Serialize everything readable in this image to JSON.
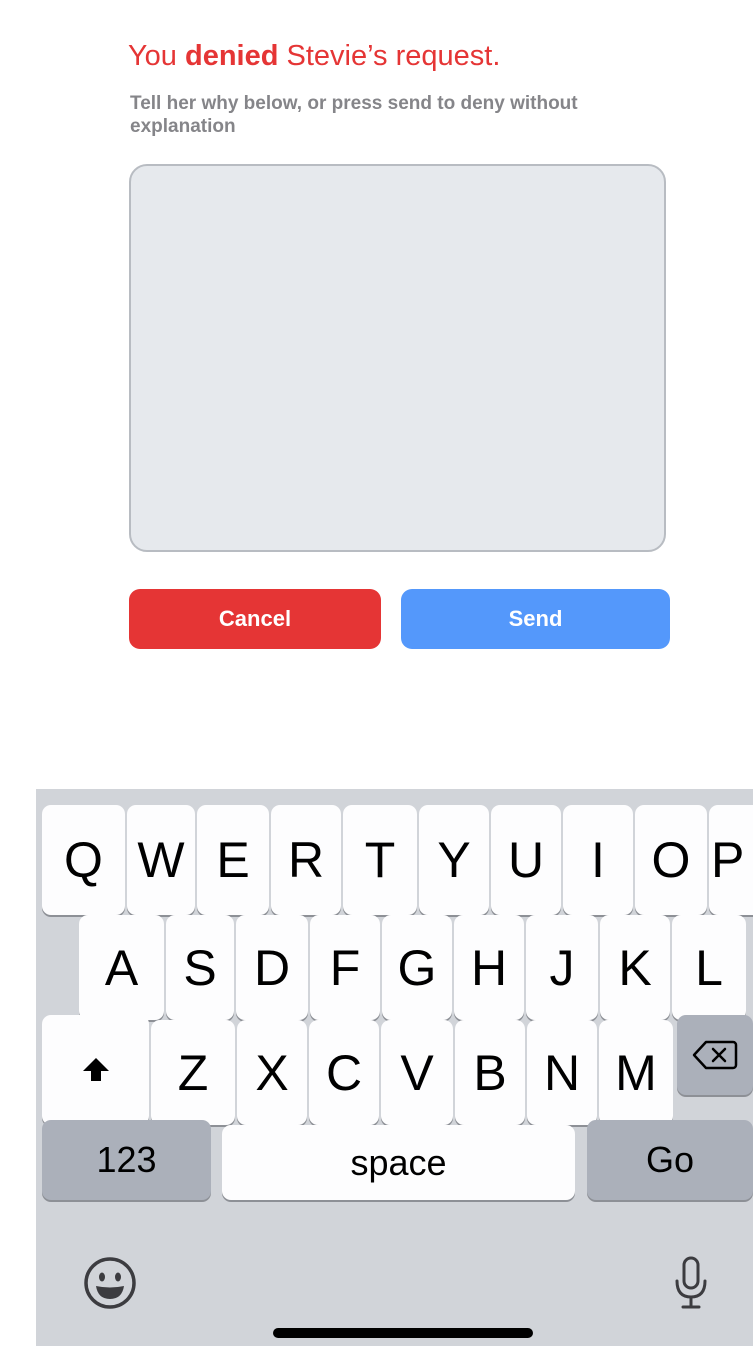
{
  "dialog": {
    "title_prefix": "You",
    "title_bold": "denied",
    "title_suffix": "Stevie’s request.",
    "subtitle": "Tell her why below, or press send to deny without explanation",
    "message_value": "",
    "cancel_label": "Cancel",
    "send_label": "Send"
  },
  "colors": {
    "danger": "#e53535",
    "primary": "#5498fb",
    "subtitle": "#858589",
    "textarea_bg": "#e6e9ed",
    "keyboard_bg": "#d1d4d9",
    "key_bg": "#fdfdfe",
    "key_dark_bg": "#abb0ba"
  },
  "keyboard": {
    "row1": [
      "Q",
      "W",
      "E",
      "R",
      "T",
      "Y",
      "U",
      "I",
      "O",
      "P"
    ],
    "row2": [
      "A",
      "S",
      "D",
      "F",
      "G",
      "H",
      "J",
      "K",
      "L"
    ],
    "row3": [
      "Z",
      "X",
      "C",
      "V",
      "B",
      "N",
      "M"
    ],
    "shift_icon": "shift-arrow-icon",
    "delete_icon": "backspace-icon",
    "numbers_label": "123",
    "space_label": "space",
    "return_label": "Go",
    "emoji_icon": "emoji-icon",
    "mic_icon": "microphone-icon"
  }
}
